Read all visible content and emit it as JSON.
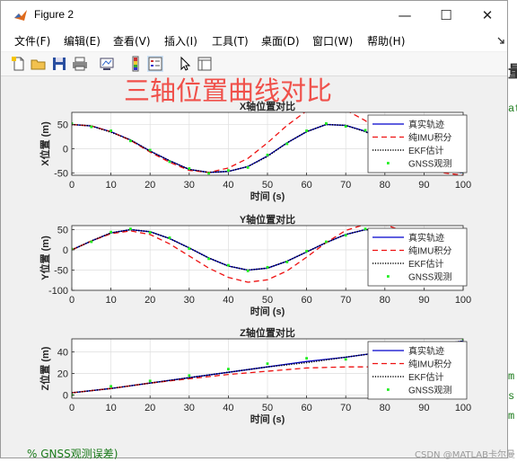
{
  "window": {
    "title": "Figure 2",
    "minimize_glyph": "—",
    "maximize_glyph": "☐",
    "close_glyph": "✕"
  },
  "menu": [
    {
      "label": "文件(F)"
    },
    {
      "label": "编辑(E)"
    },
    {
      "label": "查看(V)"
    },
    {
      "label": "插入(I)"
    },
    {
      "label": "工具(T)"
    },
    {
      "label": "桌面(D)"
    },
    {
      "label": "窗口(W)"
    },
    {
      "label": "帮助(H)"
    }
  ],
  "toolbar": [
    {
      "icon": "new-figure-icon"
    },
    {
      "icon": "open-file-icon"
    },
    {
      "icon": "save-icon"
    },
    {
      "icon": "print-icon"
    },
    {
      "icon": "link-plot-icon"
    },
    {
      "icon": "colorbar-icon"
    },
    {
      "icon": "legend-icon"
    },
    {
      "icon": "pointer-icon"
    },
    {
      "icon": "property-inspector-icon"
    }
  ],
  "annotation": {
    "text": "三轴位置曲线对比",
    "color": "#f0504a"
  },
  "colors": {
    "true_track": "#0000cc",
    "imu_only": "#ee1111",
    "ekf": "#000000",
    "gnss": "#22ee22"
  },
  "chart_data": [
    {
      "type": "line",
      "title": "X轴位置对比",
      "xlabel": "时间 (s)",
      "ylabel": "X位置 (m)",
      "xlim": [
        0,
        100
      ],
      "ylim": [
        -55,
        75
      ],
      "xticks": [
        0,
        10,
        20,
        30,
        40,
        50,
        60,
        70,
        80,
        90,
        100
      ],
      "yticks": [
        -50,
        0,
        50
      ],
      "grid": true,
      "legend_position": "top-right",
      "x": [
        0,
        5,
        10,
        15,
        20,
        25,
        30,
        35,
        40,
        45,
        50,
        55,
        60,
        65,
        70,
        75,
        80,
        85,
        90,
        95,
        100
      ],
      "series": [
        {
          "name": "真实轨迹",
          "style": "solid",
          "values": [
            50,
            47,
            35,
            18,
            -5,
            -25,
            -43,
            -49,
            -47,
            -37,
            -15,
            12,
            35,
            50,
            48,
            36,
            12,
            -10,
            -30,
            -45,
            -50
          ]
        },
        {
          "name": "纯IMU积分",
          "style": "dashed",
          "values": [
            50,
            47,
            35,
            17,
            -7,
            -28,
            -45,
            -49,
            -40,
            -20,
            12,
            48,
            78,
            88,
            80,
            58,
            26,
            -8,
            -35,
            -50,
            -55
          ]
        },
        {
          "name": "EKF估计",
          "style": "dotted",
          "values": [
            50,
            47,
            34,
            18,
            -5,
            -25,
            -43,
            -49,
            -47,
            -37,
            -16,
            12,
            35,
            50,
            48,
            35,
            12,
            -10,
            -30,
            -45,
            -50
          ]
        },
        {
          "name": "GNSS观测",
          "style": "points",
          "values": [
            52,
            45,
            37,
            16,
            -3,
            -27,
            -41,
            -51,
            -45,
            -39,
            -13,
            10,
            37,
            52,
            46,
            38,
            10,
            -12,
            -28,
            -47,
            -48
          ]
        }
      ]
    },
    {
      "type": "line",
      "title": "Y轴位置对比",
      "xlabel": "时间 (s)",
      "ylabel": "Y位置 (m)",
      "xlim": [
        0,
        100
      ],
      "ylim": [
        -100,
        60
      ],
      "xticks": [
        0,
        10,
        20,
        30,
        40,
        50,
        60,
        70,
        80,
        90,
        100
      ],
      "yticks": [
        -100,
        -50,
        0,
        50
      ],
      "grid": true,
      "legend_position": "top-right",
      "x": [
        0,
        5,
        10,
        15,
        20,
        25,
        30,
        35,
        40,
        45,
        50,
        55,
        60,
        65,
        70,
        75,
        80,
        85,
        90,
        95,
        100
      ],
      "series": [
        {
          "name": "真实轨迹",
          "style": "solid",
          "values": [
            0,
            22,
            42,
            50,
            45,
            28,
            5,
            -20,
            -40,
            -50,
            -45,
            -28,
            -5,
            18,
            38,
            50,
            48,
            35,
            12,
            -10,
            -30
          ]
        },
        {
          "name": "纯IMU积分",
          "style": "dashed",
          "values": [
            0,
            22,
            40,
            47,
            38,
            15,
            -15,
            -45,
            -68,
            -80,
            -74,
            -52,
            -18,
            18,
            48,
            63,
            62,
            46,
            18,
            -12,
            -40
          ]
        },
        {
          "name": "EKF估计",
          "style": "dotted",
          "values": [
            0,
            22,
            42,
            50,
            45,
            28,
            5,
            -20,
            -40,
            -50,
            -45,
            -28,
            -5,
            18,
            38,
            50,
            48,
            35,
            12,
            -10,
            -30
          ]
        },
        {
          "name": "GNSS观测",
          "style": "points",
          "values": [
            2,
            20,
            44,
            52,
            43,
            30,
            3,
            -22,
            -38,
            -52,
            -43,
            -30,
            -3,
            20,
            36,
            52,
            46,
            37,
            10,
            -12,
            -28
          ]
        }
      ]
    },
    {
      "type": "line",
      "title": "Z轴位置对比",
      "xlabel": "时间 (s)",
      "ylabel": "Z位置 (m)",
      "xlim": [
        0,
        100
      ],
      "ylim": [
        -3,
        52
      ],
      "xticks": [
        0,
        10,
        20,
        30,
        40,
        50,
        60,
        70,
        80,
        90,
        100
      ],
      "yticks": [
        0,
        20,
        40
      ],
      "grid": true,
      "legend_position": "top-right",
      "x": [
        0,
        10,
        20,
        30,
        40,
        50,
        60,
        70,
        80,
        90,
        100
      ],
      "series": [
        {
          "name": "真实轨迹",
          "style": "solid",
          "values": [
            2,
            6,
            11,
            16,
            21,
            26,
            31,
            35,
            40,
            45,
            50
          ]
        },
        {
          "name": "纯IMU积分",
          "style": "dashed",
          "values": [
            2,
            6,
            11,
            15,
            19,
            22,
            25,
            26,
            26,
            25,
            22
          ]
        },
        {
          "name": "EKF估计",
          "style": "dotted",
          "values": [
            2,
            6,
            11,
            16,
            21,
            26,
            30,
            35,
            40,
            45,
            50
          ]
        },
        {
          "name": "GNSS观测",
          "style": "points",
          "values": [
            0,
            8,
            13,
            18,
            24,
            29,
            34,
            33,
            44,
            46,
            52
          ]
        }
      ]
    }
  ],
  "background": {
    "right_glyphs": [
      "量",
      "at",
      "m",
      "s",
      "m"
    ],
    "bottom_text": "% GNSS观测误差)",
    "watermark": "CSDN @MATLAB卡尔曼"
  }
}
